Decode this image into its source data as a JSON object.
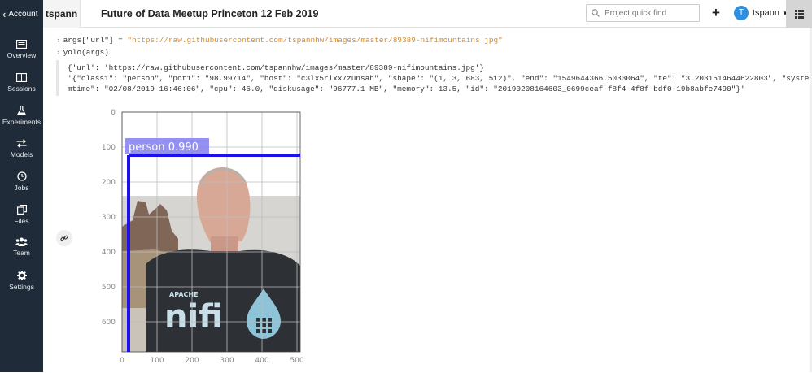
{
  "sidebar": {
    "back_label": "Account",
    "items": [
      {
        "label": "Overview",
        "icon": "overview-icon"
      },
      {
        "label": "Sessions",
        "icon": "sessions-icon"
      },
      {
        "label": "Experiments",
        "icon": "flask-icon"
      },
      {
        "label": "Models",
        "icon": "arrows-icon"
      },
      {
        "label": "Jobs",
        "icon": "clock-icon"
      },
      {
        "label": "Files",
        "icon": "files-icon"
      },
      {
        "label": "Team",
        "icon": "team-icon"
      },
      {
        "label": "Settings",
        "icon": "gear-icon"
      }
    ]
  },
  "topbar": {
    "project_owner": "tspann",
    "project_title": "Future of Data Meetup Princeton 12 Feb 2019",
    "search_placeholder": "Project quick find",
    "user_initial": "T",
    "user_name": "tspann"
  },
  "code": {
    "line1_var": "args[\"url\"] = ",
    "line1_str": "\"https://raw.githubusercontent.com/tspannhw/images/master/89389-nifimountains.jpg\"",
    "line2": "yolo(args)"
  },
  "output": {
    "line1": "{'url': 'https://raw.githubusercontent.com/tspannhw/images/master/89389-nifimountains.jpg'}",
    "line2": "'{\"class1\": \"person\", \"pct1\": \"98.99714\", \"host\": \"c3lx5rlxx7zunsah\", \"shape\": \"(1, 3, 683, 512)\", \"end\": \"1549644366.5033064\", \"te\": \"3.2031514644622803\", \"syste",
    "line3": "mtime\": \"02/08/2019 16:46:06\", \"cpu\": 46.0, \"diskusage\": \"96777.1 MB\", \"memory\": 13.5, \"id\": \"20190208164603_0699ceaf-f8f4-4f8f-bdf0-19b8abfe7490\"}'"
  },
  "plot": {
    "xticks": [
      "0",
      "100",
      "200",
      "300",
      "400",
      "500"
    ],
    "yticks": [
      "0",
      "100",
      "200",
      "300",
      "400",
      "500",
      "600"
    ],
    "detection_label": "person 0.990",
    "box_color": "#1a10f0",
    "label_bg": "#8a85ee"
  },
  "colors": {
    "sidebar_bg": "#1f2b38",
    "accent": "#2f8fdd"
  }
}
